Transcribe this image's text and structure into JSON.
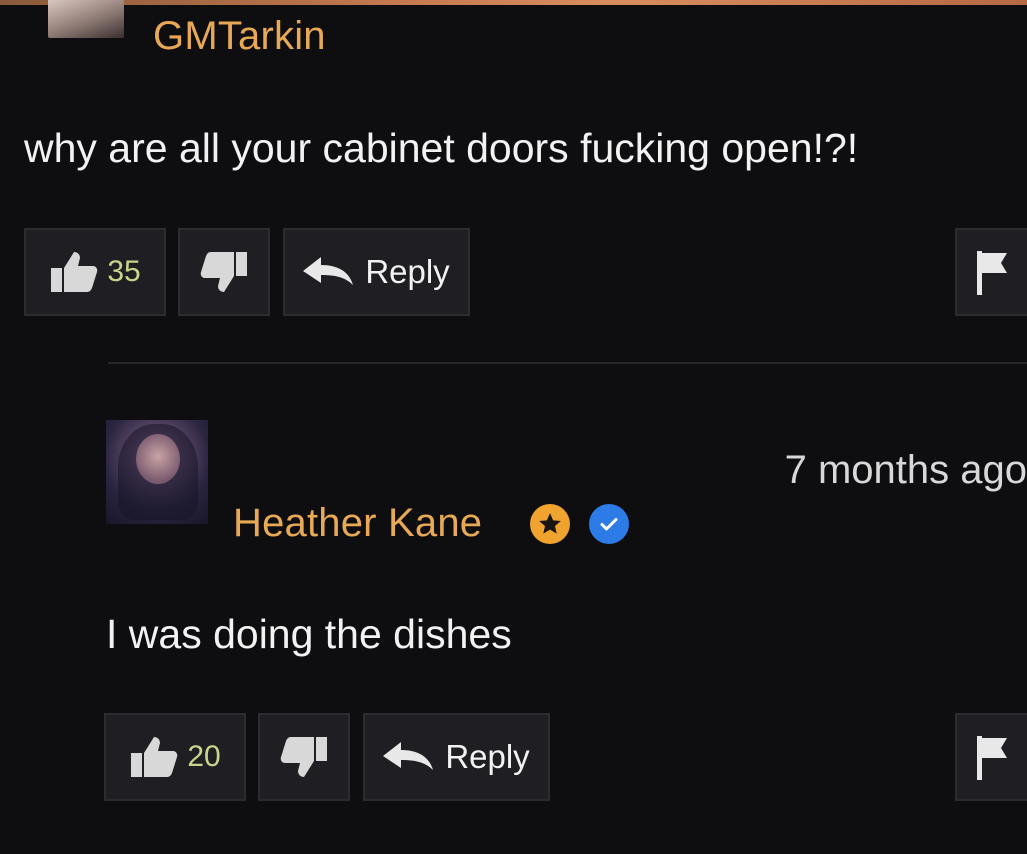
{
  "comments": [
    {
      "username": "GMTarkin",
      "text": "why are all your cabinet doors fucking open!?!",
      "likes": "35",
      "reply_label": "Reply"
    },
    {
      "username": "Heather Kane",
      "timestamp": "7 months ago",
      "text": "I was doing the dishes",
      "likes": "20",
      "reply_label": "Reply"
    }
  ],
  "icons": [
    "thumbs-up-icon",
    "thumbs-down-icon",
    "reply-arrow-icon",
    "flag-icon",
    "star-badge-icon",
    "verified-check-icon"
  ],
  "colors": {
    "username": "#e8a957",
    "background": "#0e0d10",
    "badge_star": "#f0a32f",
    "badge_verified": "#2d7be6",
    "count": "#c9d58a"
  }
}
